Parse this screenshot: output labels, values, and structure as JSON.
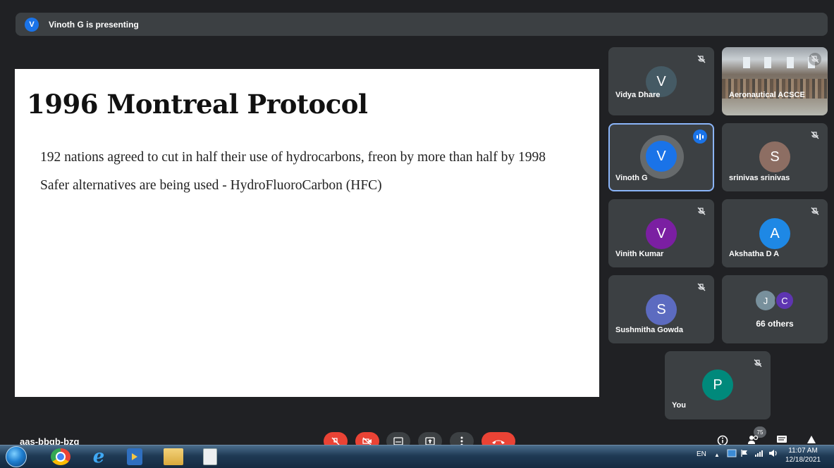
{
  "banner": {
    "avatar_initial": "V",
    "text": "Vinoth G is presenting"
  },
  "slide": {
    "title": "1996 Montreal Protocol",
    "bullets": [
      "192 nations agreed to cut in half their use of hydrocarbons, freon by more than half by 1998",
      "Safer alternatives are being used - HydroFluoroCarbon (HFC)"
    ]
  },
  "participants": [
    {
      "name": "Vidya Dhare",
      "initial": "V",
      "color": "#455a64",
      "muted": true
    },
    {
      "name": "Aeronautical ACSCE",
      "muted": true,
      "video": true
    },
    {
      "name": "Vinoth G",
      "initial": "V",
      "color": "#1a73e8",
      "speaking": true
    },
    {
      "name": "srinivas srinivas",
      "initial": "S",
      "color": "#8d6e63",
      "muted": true
    },
    {
      "name": "Vinith Kumar",
      "initial": "V",
      "color": "#7b1fa2",
      "muted": true
    },
    {
      "name": "Akshatha D A",
      "initial": "A",
      "color": "#1e88e5",
      "muted": true
    },
    {
      "name": "Sushmitha Gowda",
      "initial": "S",
      "color": "#5c6bc0",
      "muted": true
    },
    {
      "name": "You",
      "initial": "P",
      "color": "#00897b",
      "muted": true
    }
  ],
  "others": {
    "initials": [
      "J",
      "C"
    ],
    "colors": [
      "#78909c",
      "#5e35b1"
    ],
    "label": "66 others"
  },
  "meeting": {
    "code": "aas-bbgb-bzg",
    "participant_count": "75"
  },
  "colors": {
    "end_call": "#ea4335",
    "tile_bg": "#3c4043",
    "page_bg": "#202124",
    "accent": "#8ab4f8"
  },
  "taskbar": {
    "lang": "EN",
    "time": "11:07 AM",
    "date": "12/18/2021"
  }
}
